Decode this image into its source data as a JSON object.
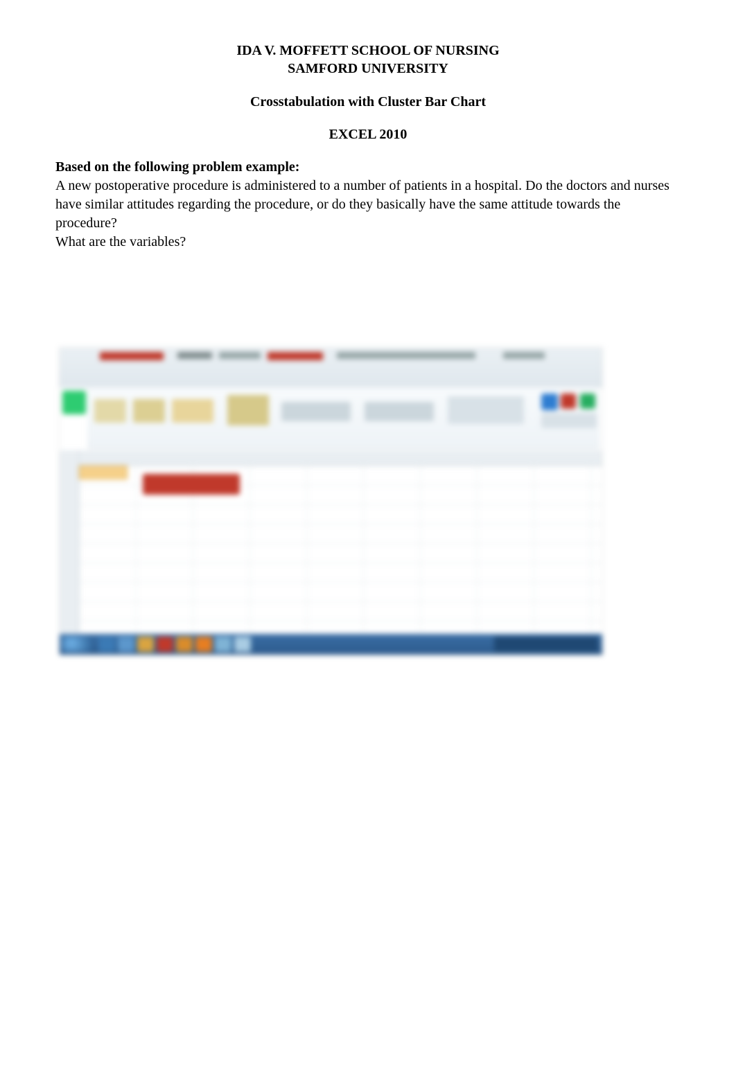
{
  "header": {
    "line1": "IDA V. MOFFETT SCHOOL OF NURSING",
    "line2": "SAMFORD UNIVERSITY"
  },
  "subtitle": "Crosstabulation with Cluster Bar Chart",
  "version": "EXCEL 2010",
  "section_heading": "Based on the following problem example:",
  "body_text": "A new postoperative procedure is administered to a number of patients in a hospital.  Do the doctors and nurses have similar attitudes regarding the procedure, or do they basically have the same attitude towards the procedure?",
  "question": "What are the variables?"
}
